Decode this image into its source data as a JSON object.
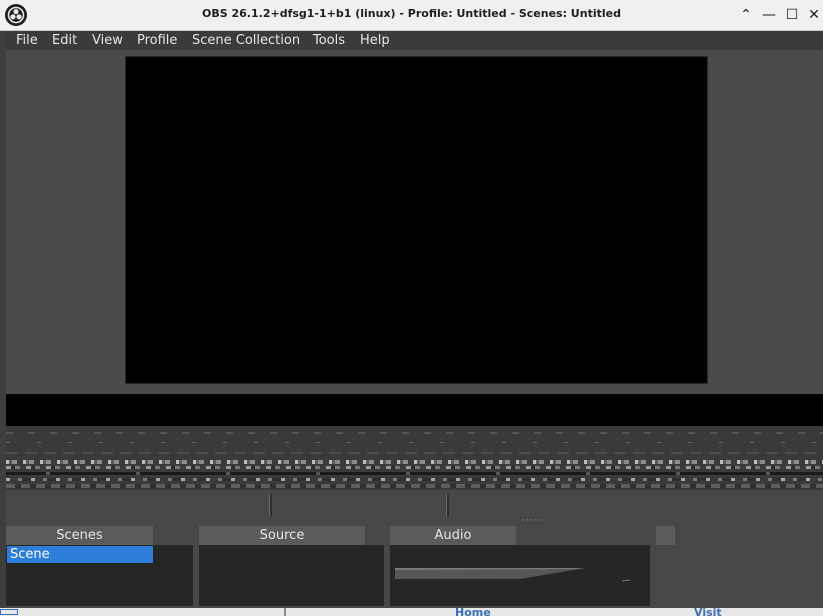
{
  "window": {
    "title": "OBS 26.1.2+dfsg1-1+b1 (linux) - Profile: Untitled - Scenes: Untitled",
    "controls": {
      "restore_glyph": "⌃",
      "minimize_glyph": "—",
      "maximize_glyph": "☐",
      "close_glyph": "✕"
    }
  },
  "menubar": {
    "items": [
      "File",
      "Edit",
      "View",
      "Profile",
      "Scene Collection",
      "Tools",
      "Help"
    ]
  },
  "docks": {
    "scenes": {
      "title": "Scenes",
      "items": [
        "Scene"
      ],
      "selected": "Scene"
    },
    "sources": {
      "title": "Source"
    },
    "audio": {
      "title": "Audio"
    }
  },
  "background_app": {
    "links": [
      "Home",
      "Visit"
    ]
  },
  "colors": {
    "accent": "#2c7ed8",
    "panel": "#474747",
    "dock_header": "#5b5b5b",
    "dock_body": "#262626"
  }
}
